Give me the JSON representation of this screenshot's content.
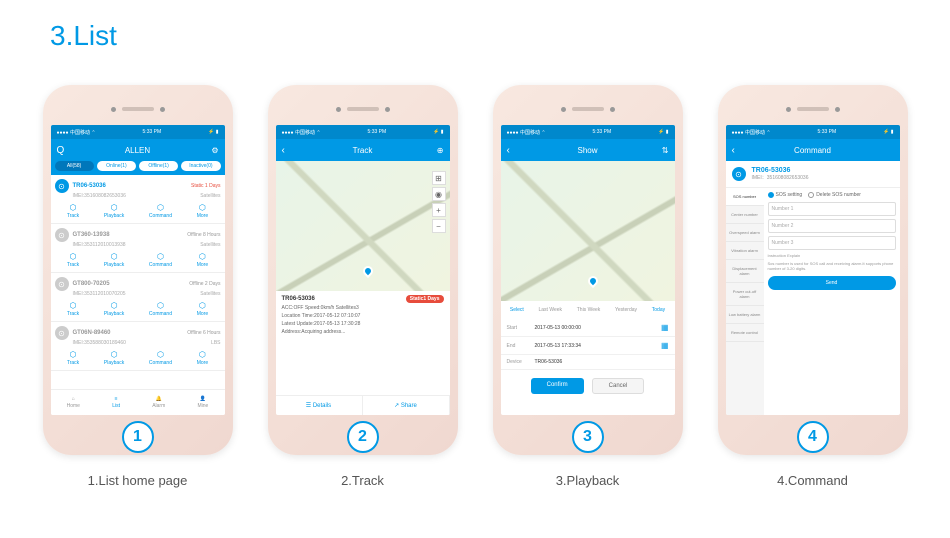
{
  "section_title": "3.List",
  "status_bar": {
    "carrier": "●●●● 中国移动 ⌃",
    "time": "5:33 PM",
    "battery": "⚡ ▮"
  },
  "phones": [
    {
      "number": "1",
      "label": "1.List home page",
      "nav": {
        "title": "ALLEN",
        "left_icon": "Q",
        "right_icon": "⚙"
      },
      "pills": [
        "All(58)",
        "Online(1)",
        "Offline(1)",
        "Inactive(0)"
      ],
      "devices": [
        {
          "name": "TR06-53036",
          "status": "Static 1 Days",
          "imei": "IMEI:351608082653036",
          "sat": "Satellites",
          "active": true
        },
        {
          "name": "GT360-13938",
          "status": "Offline 8 Hours",
          "imei": "IMEI:353112010013938",
          "sat": "Satellites",
          "active": false
        },
        {
          "name": "GT800-70205",
          "status": "Offline 2 Days",
          "imei": "IMEI:353112010070205",
          "sat": "Satellites",
          "active": false
        },
        {
          "name": "GT06N-89460",
          "status": "Offline 6 Hours",
          "imei": "IMEI:353588030189460",
          "sat": "LBS",
          "active": false
        }
      ],
      "actions": [
        "Track",
        "Playback",
        "Command",
        "More"
      ],
      "bottom_nav": [
        "Home",
        "List",
        "Alarm",
        "Mine"
      ]
    },
    {
      "number": "2",
      "label": "2.Track",
      "nav": {
        "title": "Track",
        "left_icon": "‹",
        "right_icon": "⊕"
      },
      "track": {
        "device": "TR06-53036",
        "badge": "Static1 Days",
        "lines": [
          "ACC:OFF  Speed:0km/h  Satellites3",
          "Location Time:2017-05-12 07:10:07",
          "Latest Update:2017-05-13 17:30:28",
          "Address:Acquiring address..."
        ],
        "footer": [
          "☰ Details",
          "↗ Share"
        ]
      }
    },
    {
      "number": "3",
      "label": "3.Playback",
      "nav": {
        "title": "Show",
        "left_icon": "‹",
        "right_icon": "⇅"
      },
      "playback": {
        "tabs": [
          "Select",
          "Last Week",
          "This Week",
          "Yesterday",
          "Today"
        ],
        "rows": [
          {
            "label": "Start",
            "value": "2017-05-13 00:00:00"
          },
          {
            "label": "End",
            "value": "2017-05-13 17:33:34"
          },
          {
            "label": "Device",
            "value": "TR06-53036"
          }
        ],
        "confirm": "Confirm",
        "cancel": "Cancel"
      }
    },
    {
      "number": "4",
      "label": "4.Command",
      "nav": {
        "title": "Command",
        "left_icon": "‹",
        "right_icon": ""
      },
      "command": {
        "device": "TR06-53036",
        "imei": "IMEI：351608082653036",
        "sidebar": [
          "SOS number",
          "Center number",
          "Overspeed alarm",
          "Vibration alarm",
          "Displacement alarm",
          "Power cut-off alarm",
          "Low battery alarm",
          "Remote control"
        ],
        "radios": [
          "SOS setting",
          "Delete SOS number"
        ],
        "inputs": [
          "Number 1",
          "Number 2",
          "Number 3"
        ],
        "note_label": "Instruction Explain",
        "note": "Sos number is used for SOS call and receiving alarm.It supports phone number of 3-20 digits.",
        "send": "Send"
      }
    }
  ]
}
